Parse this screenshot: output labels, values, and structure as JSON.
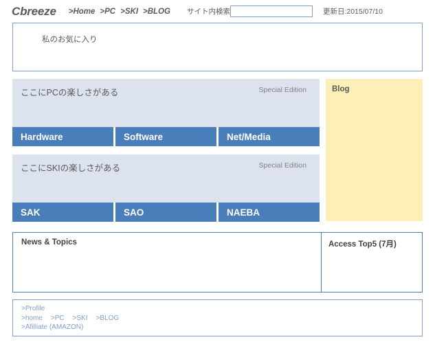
{
  "header": {
    "logo": "Cbreeze",
    "nav": [
      {
        "label": ">Home"
      },
      {
        "label": ">PC"
      },
      {
        "label": ">SKI"
      },
      {
        "label": ">BLOG"
      }
    ],
    "search": {
      "label": "サイト内検索",
      "value": "",
      "placeholder": ""
    },
    "update": "更新日:2015/07/10"
  },
  "favorites": {
    "title": "私のお気に入り"
  },
  "sections": [
    {
      "id": "pc",
      "heading": "ここにPCの楽しさがある",
      "edition": "Special Edition",
      "buttons": [
        {
          "label": "Hardware"
        },
        {
          "label": "Software"
        },
        {
          "label": "Net/Media"
        }
      ]
    },
    {
      "id": "ski",
      "heading": "ここにSKIの楽しさがある",
      "edition": "Special Edition",
      "buttons": [
        {
          "label": "SAK"
        },
        {
          "label": "SAO"
        },
        {
          "label": "NAEBA"
        }
      ]
    }
  ],
  "blog": {
    "title": "Blog"
  },
  "news": {
    "title": "News & Topics",
    "access_title": "Access Top5 (7月)"
  },
  "footer": {
    "profile": ">Profile",
    "nav": [
      {
        "label": ">home"
      },
      {
        "label": ">PC"
      },
      {
        "label": ">SKI"
      },
      {
        "label": ">BLOG"
      }
    ],
    "affiliate": ">Afilliate (AMAZON)"
  },
  "colors": {
    "accent_blue": "#4a7ebb",
    "panel_blue": "#dce3ef",
    "border_blue": "#7d9fc9",
    "blog_yellow": "#fcf0b8",
    "text_gray": "#595959"
  }
}
